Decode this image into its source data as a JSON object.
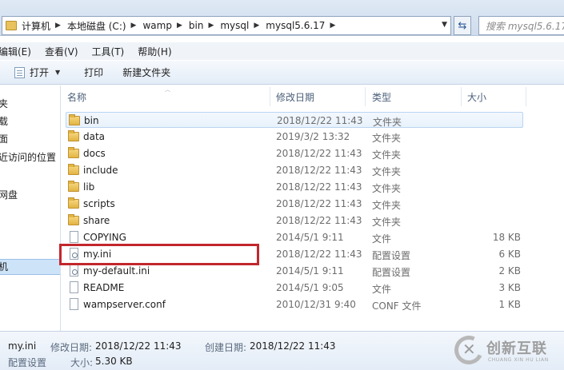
{
  "address": {
    "crumbs": [
      "计算机",
      "本地磁盘 (C:)",
      "wamp",
      "bin",
      "mysql",
      "mysql5.6.17"
    ],
    "search_placeholder": "搜索 mysql5.6.17"
  },
  "menu": [
    "编辑(E)",
    "查看(V)",
    "工具(T)",
    "帮助(H)"
  ],
  "toolbar": {
    "open_label": "打开",
    "print_label": "打印",
    "new_folder_label": "新建文件夹"
  },
  "nav": {
    "items": [
      "夹",
      "载",
      "面",
      "近访问的位置",
      "网盘",
      "机"
    ],
    "selected_index": 5
  },
  "columns": {
    "name": "名称",
    "modified": "修改日期",
    "type": "类型",
    "size": "大小"
  },
  "files": [
    {
      "name": "bin",
      "modified": "2018/12/22 11:43",
      "type": "文件夹",
      "size": "",
      "icon": "folder-icon"
    },
    {
      "name": "data",
      "modified": "2019/3/2 13:32",
      "type": "文件夹",
      "size": "",
      "icon": "folder-icon"
    },
    {
      "name": "docs",
      "modified": "2018/12/22 11:43",
      "type": "文件夹",
      "size": "",
      "icon": "folder-icon"
    },
    {
      "name": "include",
      "modified": "2018/12/22 11:43",
      "type": "文件夹",
      "size": "",
      "icon": "folder-icon"
    },
    {
      "name": "lib",
      "modified": "2018/12/22 11:43",
      "type": "文件夹",
      "size": "",
      "icon": "folder-icon"
    },
    {
      "name": "scripts",
      "modified": "2018/12/22 11:43",
      "type": "文件夹",
      "size": "",
      "icon": "folder-icon"
    },
    {
      "name": "share",
      "modified": "2018/12/22 11:43",
      "type": "文件夹",
      "size": "",
      "icon": "folder-icon"
    },
    {
      "name": "COPYING",
      "modified": "2014/5/1 9:11",
      "type": "文件",
      "size": "18 KB",
      "icon": "file-icon"
    },
    {
      "name": "my.ini",
      "modified": "2018/12/22 11:43",
      "type": "配置设置",
      "size": "6 KB",
      "icon": "config-file-icon"
    },
    {
      "name": "my-default.ini",
      "modified": "2014/5/1 9:11",
      "type": "配置设置",
      "size": "2 KB",
      "icon": "config-file-icon"
    },
    {
      "name": "README",
      "modified": "2014/5/1 9:05",
      "type": "文件",
      "size": "3 KB",
      "icon": "file-icon"
    },
    {
      "name": "wampserver.conf",
      "modified": "2010/12/31 9:40",
      "type": "CONF 文件",
      "size": "1 KB",
      "icon": "file-icon"
    }
  ],
  "hover_row_index": 0,
  "highlight_color": "#c2272d",
  "details": {
    "name": "my.ini",
    "modified_label": "修改日期:",
    "modified_value": "2018/12/22 11:43",
    "created_label": "创建日期:",
    "created_value": "2018/12/22 11:43",
    "type_value": "配置设置",
    "size_label": "大小:",
    "size_value": "5.30 KB"
  },
  "watermark": {
    "cn": "创新互联",
    "en": "CHUANG XIN HU LIAN"
  }
}
